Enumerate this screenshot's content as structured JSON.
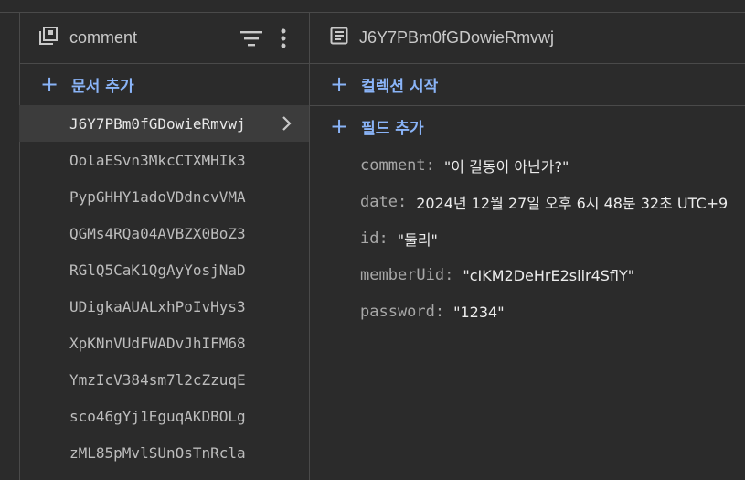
{
  "collection": {
    "name": "comment",
    "add_document_label": "문서 추가"
  },
  "document": {
    "id": "J6Y7PBm0fGDowieRmvwj",
    "start_collection_label": "컬렉션 시작",
    "add_field_label": "필드 추가",
    "fields": [
      {
        "key": "comment",
        "value": "\"이 길동이 아닌가?\""
      },
      {
        "key": "date",
        "value": "2024년 12월 27일 오후 6시 48분 32초 UTC+9"
      },
      {
        "key": "id",
        "value": "\"둘리\""
      },
      {
        "key": "memberUid",
        "value": "\"cIKM2DeHrE2siir4SflY\""
      },
      {
        "key": "password",
        "value": "\"1234\""
      }
    ]
  },
  "documents": [
    "J6Y7PBm0fGDowieRmvwj",
    "OolaESvn3MkcCTXMHIk3",
    "PypGHHY1adoVDdncvVMA",
    "QGMs4RQa04AVBZX0BoZ3",
    "RGlQ5CaK1QgAyYosjNaD",
    "UDigkaAUALxhPoIvHys3",
    "XpKNnVUdFWADvJhIFM68",
    "YmzIcV384sm7l2cZzuqE",
    "sco46gYj1EguqAKDBOLg",
    "zML85pMvlSUnOsTnRcla"
  ],
  "accent_color": "#8ab4f8"
}
